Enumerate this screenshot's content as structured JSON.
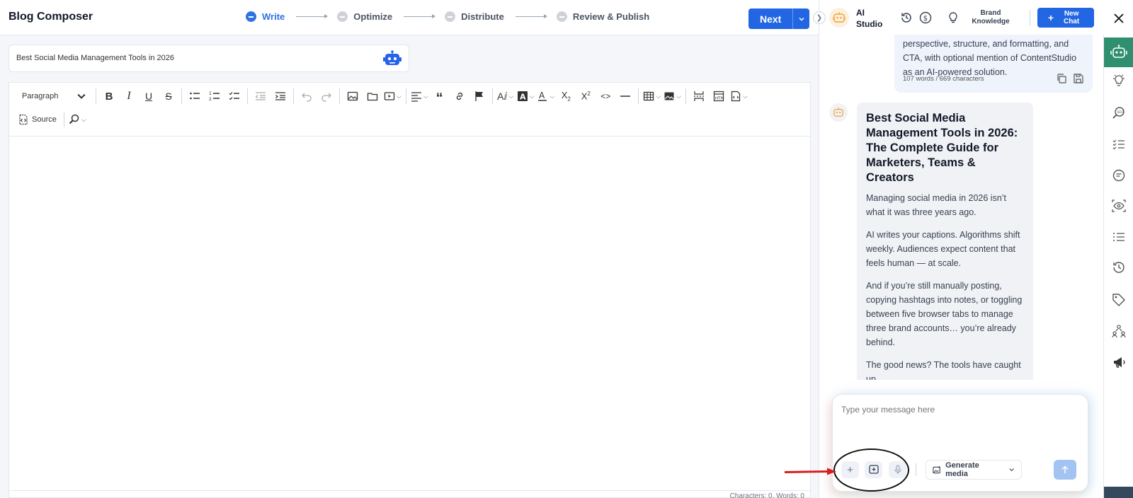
{
  "header": {
    "app_title": "Blog Composer",
    "steps": [
      {
        "label": "Write",
        "active": true
      },
      {
        "label": "Optimize",
        "active": false
      },
      {
        "label": "Distribute",
        "active": false
      },
      {
        "label": "Review & Publish",
        "active": false
      }
    ],
    "next_label": "Next"
  },
  "title_input": {
    "value": "Best Social Media Management Tools in 2026",
    "icon": "robot-icon"
  },
  "toolbar": {
    "paragraph_select": "Paragraph",
    "source_label": "Source"
  },
  "editor": {
    "counter": "Characters: 0, Words: 0"
  },
  "ai_panel": {
    "title": "AI Studio",
    "brand_knowledge_label": "Brand Knowledge",
    "new_chat_label": "New Chat",
    "user_message": {
      "text": "perspective, structure, and formatting, and CTA, with optional mention of ContentStudio as an AI-powered solution.",
      "meta": "107 words / 669 characters"
    },
    "bot_message": {
      "heading": "Best Social Media Management Tools in 2026: The Complete Guide for Marketers, Teams & Creators",
      "paragraphs": [
        "Managing social media in 2026 isn’t what it was three years ago.",
        "AI writes your captions. Algorithms shift weekly. Audiences expect content that feels human — at scale.",
        "And if you’re still manually posting, copying hashtags into notes, or toggling between five browser tabs to manage three brand accounts… you’re already behind.",
        "The good news? The tools have caught up."
      ]
    },
    "composer": {
      "placeholder": "Type your message here",
      "generate_media_label": "Generate media"
    }
  },
  "colors": {
    "accent": "#2266e3",
    "active_step": "#2f73e0",
    "rail_active": "#2f8f6f",
    "annotation_arrow": "#d91c1c"
  }
}
